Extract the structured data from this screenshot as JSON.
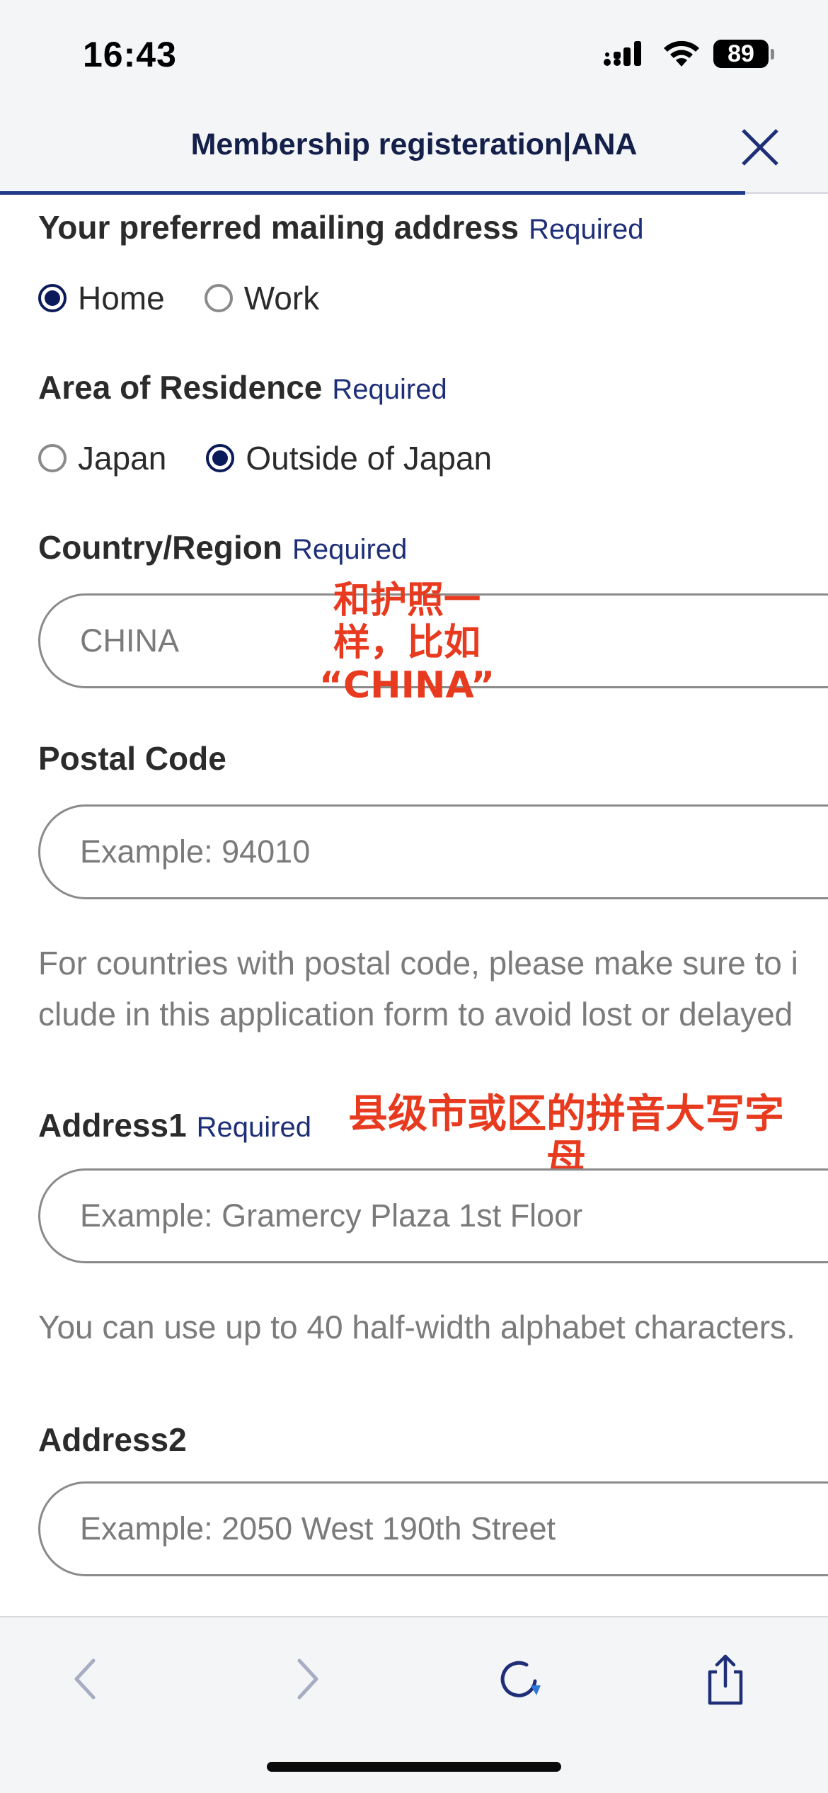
{
  "status_bar": {
    "time": "16:43",
    "battery": "89",
    "icons": [
      "cellular-signal-icon",
      "wifi-icon",
      "battery-icon"
    ]
  },
  "header": {
    "title": "Membership registeration|ANA",
    "close_icon": "close-icon",
    "progress_fraction": 0.9
  },
  "form": {
    "mailing": {
      "label": "Your preferred mailing address",
      "required": "Required",
      "options": [
        {
          "label": "Home",
          "checked": true
        },
        {
          "label": "Work",
          "checked": false
        }
      ]
    },
    "residence": {
      "label": "Area of Residence",
      "required": "Required",
      "options": [
        {
          "label": "Japan",
          "checked": false
        },
        {
          "label": "Outside of Japan",
          "checked": true
        }
      ]
    },
    "country": {
      "label": "Country/Region",
      "required": "Required",
      "value": "CHINA"
    },
    "postal": {
      "label": "Postal Code",
      "placeholder": "Example: 94010",
      "help_line1": "For countries with postal code, please make sure to i",
      "help_line2": "clude in this application form to avoid lost or delayed"
    },
    "address1": {
      "label": "Address1",
      "required": "Required",
      "placeholder": "Example: Gramercy Plaza 1st Floor",
      "help": "You can use up to 40 half-width alphabet characters."
    },
    "address2": {
      "label": "Address2",
      "placeholder": "Example: 2050 West 190th Street"
    }
  },
  "annotations": {
    "country_note_line1": "和护照一",
    "country_note_line2": "样，比如",
    "country_note_line3": "“CHINA”",
    "address_note_line1": "县级市或区的拼音大写字",
    "address_note_line2": "母"
  },
  "toolbar": {
    "icons": [
      "back-icon",
      "forward-icon",
      "reload-icon",
      "share-icon"
    ]
  },
  "colors": {
    "accent": "#1e2f78",
    "radio_checked": "#0b1a5a",
    "annotation": "#e83a1f",
    "bar_background": "#f4f5f7"
  }
}
